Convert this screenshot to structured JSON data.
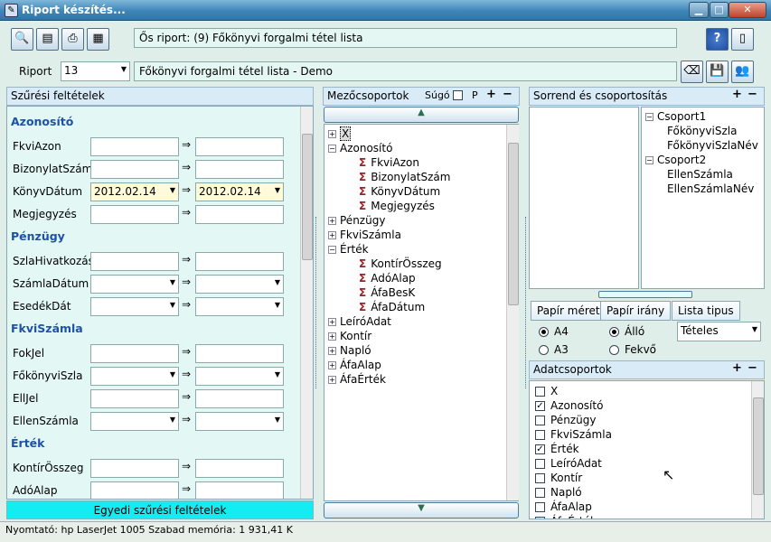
{
  "window": {
    "title": "Riport készítés...",
    "min": "▁",
    "max": "□",
    "close": "✕"
  },
  "toolbar": {
    "parent_report": "Ős riport: (9)  Főkönyvi forgalmi tétel lista",
    "help": "?",
    "exit": "▯"
  },
  "report": {
    "label": "Riport",
    "number": "13",
    "name": "Főkönyvi forgalmi tétel lista - Demo"
  },
  "filter_panel": {
    "title": "Szűrési feltételek",
    "footer": "Egyedi szűrési feltételek",
    "sections": [
      {
        "title": "Azonosító",
        "fields": [
          {
            "label": "FkviAzon",
            "from": "",
            "to": ""
          },
          {
            "label": "BizonylatSzám",
            "from": "",
            "to": ""
          },
          {
            "label": "KönyvDátum",
            "from": "2012.02.14",
            "to": "2012.02.14"
          },
          {
            "label": "Megjegyzés",
            "from": "",
            "to": ""
          }
        ]
      },
      {
        "title": "Pénzügy",
        "fields": [
          {
            "label": "SzlaHivatkozás",
            "from": "",
            "to": ""
          },
          {
            "label": "SzámlaDátum",
            "from": "",
            "to": ""
          },
          {
            "label": "EsedékDát",
            "from": "",
            "to": ""
          }
        ]
      },
      {
        "title": "FkviSzámla",
        "fields": [
          {
            "label": "FokJel",
            "from": "",
            "to": ""
          },
          {
            "label": "FőkönyviSzla",
            "from": "",
            "to": ""
          },
          {
            "label": "EllJel",
            "from": "",
            "to": ""
          },
          {
            "label": "EllenSzámla",
            "from": "",
            "to": ""
          }
        ]
      },
      {
        "title": "Érték",
        "fields": [
          {
            "label": "KontírÖsszeg",
            "from": "",
            "to": ""
          },
          {
            "label": "AdóAlap",
            "from": "",
            "to": ""
          }
        ]
      }
    ],
    "arrow": "⇒"
  },
  "field_groups": {
    "title": "Mezőcsoportok",
    "help": "Súgó",
    "p": "P",
    "tree": [
      {
        "text": "X",
        "level": 0,
        "sym": "pm"
      },
      {
        "text": "Azonosító",
        "level": 0,
        "sym": "pm"
      },
      {
        "text": "FkviAzon",
        "level": 1,
        "sym": "sig"
      },
      {
        "text": "BizonylatSzám",
        "level": 1,
        "sym": "sig"
      },
      {
        "text": "KönyvDátum",
        "level": 1,
        "sym": "sig"
      },
      {
        "text": "Megjegyzés",
        "level": 1,
        "sym": "sig"
      },
      {
        "text": "Pénzügy",
        "level": 0,
        "sym": "pm"
      },
      {
        "text": "FkviSzámla",
        "level": 0,
        "sym": "pm"
      },
      {
        "text": "Érték",
        "level": 0,
        "sym": "pm"
      },
      {
        "text": "KontírÖsszeg",
        "level": 1,
        "sym": "sig"
      },
      {
        "text": "AdóAlap",
        "level": 1,
        "sym": "sig"
      },
      {
        "text": "ÁfaBesK",
        "level": 1,
        "sym": "sig"
      },
      {
        "text": "ÁfaDátum",
        "level": 1,
        "sym": "sig"
      },
      {
        "text": "LeíróAdat",
        "level": 0,
        "sym": "pm"
      },
      {
        "text": "Kontír",
        "level": 0,
        "sym": "pm"
      },
      {
        "text": "Napló",
        "level": 0,
        "sym": "pm"
      },
      {
        "text": "ÁfaAlap",
        "level": 0,
        "sym": "pm"
      },
      {
        "text": "ÁfaÉrték",
        "level": 0,
        "sym": "pm"
      }
    ]
  },
  "sorting": {
    "title": "Sorrend és csoportosítás",
    "tree": [
      {
        "text": "Csoport1",
        "level": 0
      },
      {
        "text": "FőkönyviSzla",
        "level": 1
      },
      {
        "text": "FőkönyviSzlaNév",
        "level": 1
      },
      {
        "text": "Csoport2",
        "level": 0
      },
      {
        "text": "EllenSzámla",
        "level": 1
      },
      {
        "text": "EllenSzámlaNév",
        "level": 1
      }
    ]
  },
  "paper": {
    "size_label": "Papír méret",
    "orient_label": "Papír irány",
    "list_label": "Lista tipus",
    "a4": "A4",
    "a3": "A3",
    "portrait": "Álló",
    "landscape": "Fekvő",
    "list_value": "Tételes"
  },
  "data_groups": {
    "title": "Adatcsoportok",
    "items": [
      {
        "text": "X",
        "checked": false
      },
      {
        "text": "Azonosító",
        "checked": true
      },
      {
        "text": "Pénzügy",
        "checked": false
      },
      {
        "text": "FkviSzámla",
        "checked": false
      },
      {
        "text": "Érték",
        "checked": true
      },
      {
        "text": "LeíróAdat",
        "checked": false
      },
      {
        "text": "Kontír",
        "checked": false
      },
      {
        "text": "Napló",
        "checked": false
      },
      {
        "text": "ÁfaAlap",
        "checked": false
      },
      {
        "text": "ÁfaÉrték",
        "checked": false
      }
    ]
  },
  "status": "Nyomtató: hp LaserJet 1005 Szabad memória: 1 931,41 K"
}
